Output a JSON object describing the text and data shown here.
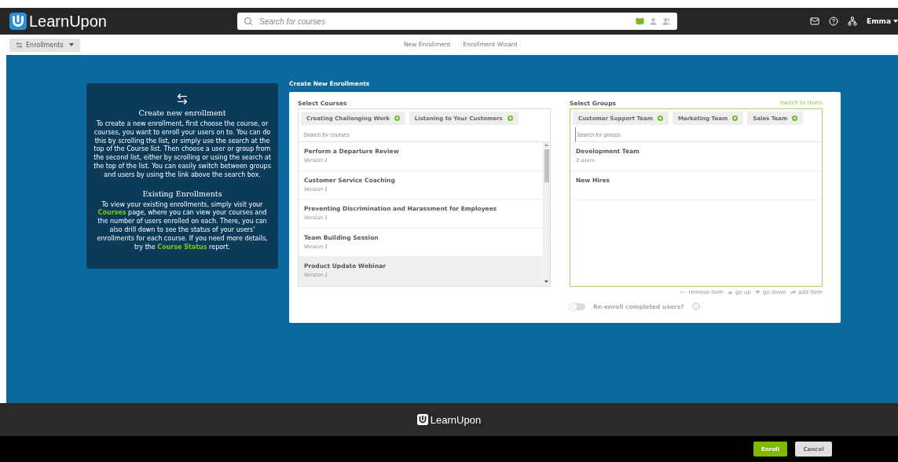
{
  "header": {
    "logo": "LearnUpon",
    "search": {
      "placeholder": "Search for courses",
      "scopes": [
        {
          "kind": "book",
          "selected": true
        },
        {
          "kind": "user",
          "selected": false
        },
        {
          "kind": "group",
          "selected": false
        }
      ]
    },
    "user": "Emma"
  },
  "subnav": {
    "menu": "Enrollments",
    "links": [
      {
        "label": "New Enrollment",
        "selected": false
      },
      {
        "label": "Enrollment Wizard",
        "selected": false
      }
    ]
  },
  "help": {
    "sections": [
      {
        "title": "Create new enrollment",
        "body": [
          {
            "kind": "text",
            "text": "To create a new enrollment, first choose the course, or courses, you want to enroll your users on to. You can do this by scrolling the list, or simply use the search at the top of the Course list. Then choose a user or group from the second list, either by scrolling or using the search at the top of the list. You can easily switch between groups and users by using the link above the search box."
          }
        ]
      },
      {
        "title": "Existing Enrollments",
        "body": [
          {
            "kind": "text",
            "text": "To view your existing enrollments, simply visit your "
          },
          {
            "kind": "link",
            "text": "Courses"
          },
          {
            "kind": "text",
            "text": " page, where you can view your courses and the number of users enrolled on each. There, you can also drill down to see the status of your users' enrollments for each course. If you need more details, try the "
          },
          {
            "kind": "link",
            "text": "Course Status"
          },
          {
            "kind": "text",
            "text": " report."
          }
        ]
      }
    ]
  },
  "form": {
    "title": "Create New Enrollments",
    "courses": {
      "label": "Select Courses",
      "tags": [
        "Creating Challenging Work",
        "Listening to Your Customers"
      ],
      "placeholder": "Search for courses",
      "focused": false,
      "items": [
        {
          "name": "Perform a Departure Review",
          "sub": "Version 1",
          "selected": false
        },
        {
          "name": "Customer Service Coaching",
          "sub": "Version 1",
          "selected": false
        },
        {
          "name": "Preventing Discrimination and Harassment for Employees",
          "sub": "Version 1",
          "selected": false
        },
        {
          "name": "Team Building Session",
          "sub": "Version 1",
          "selected": false
        },
        {
          "name": "Product Update Webinar",
          "sub": "Version 1",
          "selected": true
        }
      ]
    },
    "groups": {
      "label": "Select Groups",
      "switch": "Switch to Users",
      "tags": [
        "Customer Support Team",
        "Marketing Team",
        "Sales Team"
      ],
      "placeholder": "Search for groups",
      "focused": true,
      "items": [
        {
          "name": "Development Team",
          "sub": "3 users",
          "selected": false
        },
        {
          "name": "New Hires",
          "selected": false
        }
      ]
    },
    "hints": [
      {
        "kind": "left",
        "text": "remove item"
      },
      {
        "kind": "up",
        "text": "go up"
      },
      {
        "kind": "down",
        "text": "go down"
      },
      {
        "kind": "enter",
        "text": "add item"
      }
    ],
    "reenroll": {
      "label": "Re-enroll completed users?",
      "on": false
    }
  },
  "footer": {
    "logo": "LearnUpon"
  },
  "actions": [
    {
      "label": "Enroll",
      "kind": "primary"
    },
    {
      "label": "Cancel",
      "kind": "secondary"
    }
  ]
}
